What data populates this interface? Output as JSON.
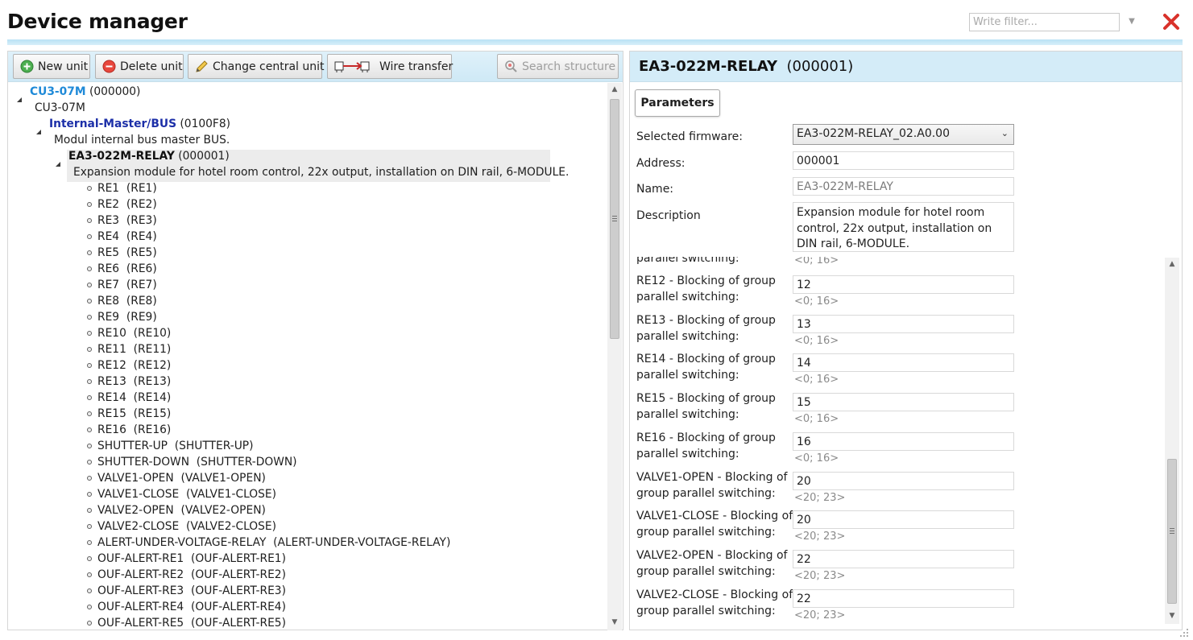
{
  "window": {
    "title": "Device manager",
    "filter_placeholder": "Write filter..."
  },
  "colors": {
    "accent_bar": "#c8e8f7",
    "close_red": "#d9322b",
    "tree_cu_link": "#1f8ad8",
    "tree_bus_link": "#1c2fa8"
  },
  "toolbar": {
    "new_unit": "New unit",
    "delete_unit": "Delete unit",
    "change_central_unit": "Change central unit",
    "wire_transfer": "Wire transfer",
    "search_structure": "Search structure"
  },
  "tree": {
    "root": {
      "name": "CU3-07M",
      "code": "(000000)",
      "desc": "CU3-07M"
    },
    "bus": {
      "name": "Internal-Master/BUS",
      "code": "(0100F8)",
      "desc": "Modul internal bus master BUS."
    },
    "module": {
      "name": "EA3-022M-RELAY",
      "code": "(000001)",
      "desc": "Expansion module for hotel room control, 22x output, installation on DIN rail, 6-MODULE."
    },
    "leaves": [
      "RE1  (RE1)",
      "RE2  (RE2)",
      "RE3  (RE3)",
      "RE4  (RE4)",
      "RE5  (RE5)",
      "RE6  (RE6)",
      "RE7  (RE7)",
      "RE8  (RE8)",
      "RE9  (RE9)",
      "RE10  (RE10)",
      "RE11  (RE11)",
      "RE12  (RE12)",
      "RE13  (RE13)",
      "RE14  (RE14)",
      "RE15  (RE15)",
      "RE16  (RE16)",
      "SHUTTER-UP  (SHUTTER-UP)",
      "SHUTTER-DOWN  (SHUTTER-DOWN)",
      "VALVE1-OPEN  (VALVE1-OPEN)",
      "VALVE1-CLOSE  (VALVE1-CLOSE)",
      "VALVE2-OPEN  (VALVE2-OPEN)",
      "VALVE2-CLOSE  (VALVE2-CLOSE)",
      "ALERT-UNDER-VOLTAGE-RELAY  (ALERT-UNDER-VOLTAGE-RELAY)",
      "OUF-ALERT-RE1  (OUF-ALERT-RE1)",
      "OUF-ALERT-RE2  (OUF-ALERT-RE2)",
      "OUF-ALERT-RE3  (OUF-ALERT-RE3)",
      "OUF-ALERT-RE4  (OUF-ALERT-RE4)",
      "OUF-ALERT-RE5  (OUF-ALERT-RE5)"
    ]
  },
  "detail": {
    "title": "EA3-022M-RELAY",
    "code": "(000001)",
    "tab": "Parameters",
    "firmware_label": "Selected firmware:",
    "firmware_value": "EA3-022M-RELAY_02.A0.00",
    "address_label": "Address:",
    "address_value": "000001",
    "name_label": "Name:",
    "name_value": "EA3-022M-RELAY",
    "description_label": "Description",
    "description_value": "Expansion module for hotel room control, 22x output, installation on DIN rail, 6-MODULE.",
    "partial_label": "parallel switching:",
    "partial_range": "<0; 16>",
    "params": [
      {
        "line1": "RE12 - Blocking of group",
        "line2": "parallel switching:",
        "value": "12",
        "range": "<0; 16>"
      },
      {
        "line1": "RE13 - Blocking of group",
        "line2": "parallel switching:",
        "value": "13",
        "range": "<0; 16>"
      },
      {
        "line1": "RE14 - Blocking of group",
        "line2": "parallel switching:",
        "value": "14",
        "range": "<0; 16>"
      },
      {
        "line1": "RE15 - Blocking of group",
        "line2": "parallel switching:",
        "value": "15",
        "range": "<0; 16>"
      },
      {
        "line1": "RE16 - Blocking of group",
        "line2": "parallel switching:",
        "value": "16",
        "range": "<0; 16>"
      },
      {
        "line1": "VALVE1-OPEN - Blocking of",
        "line2": "group parallel switching:",
        "value": "20",
        "range": "<20; 23>"
      },
      {
        "line1": "VALVE1-CLOSE - Blocking of",
        "line2": "group parallel switching:",
        "value": "20",
        "range": "<20; 23>"
      },
      {
        "line1": "VALVE2-OPEN - Blocking of",
        "line2": "group parallel switching:",
        "value": "22",
        "range": "<20; 23>"
      },
      {
        "line1": "VALVE2-CLOSE - Blocking of",
        "line2": "group parallel switching:",
        "value": "22",
        "range": "<20; 23>"
      }
    ]
  }
}
